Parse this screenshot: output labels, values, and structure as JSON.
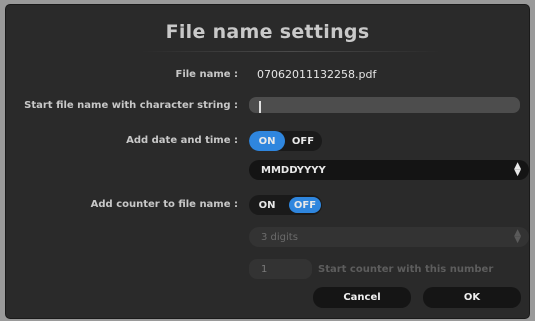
{
  "dialog": {
    "title": "File name settings"
  },
  "file_name": {
    "label": "File name :",
    "value": "07062011132258.pdf"
  },
  "start_string": {
    "label": "Start file name with character string :",
    "value": ""
  },
  "add_date_time": {
    "label": "Add date and time :",
    "on_label": "ON",
    "off_label": "OFF",
    "state": "ON"
  },
  "date_format": {
    "selected": "MMDDYYYY"
  },
  "add_counter": {
    "label": "Add counter to file name :",
    "on_label": "ON",
    "off_label": "OFF",
    "state": "OFF"
  },
  "counter_digits": {
    "selected": "3 digits"
  },
  "counter_start": {
    "value": "1",
    "hint": "Start counter with this number"
  },
  "buttons": {
    "cancel": "Cancel",
    "ok": "OK"
  },
  "colors": {
    "accent": "#2f86de",
    "background": "#2a2a2a"
  },
  "icons": {
    "select_arrows": "up-down-arrows-icon"
  }
}
